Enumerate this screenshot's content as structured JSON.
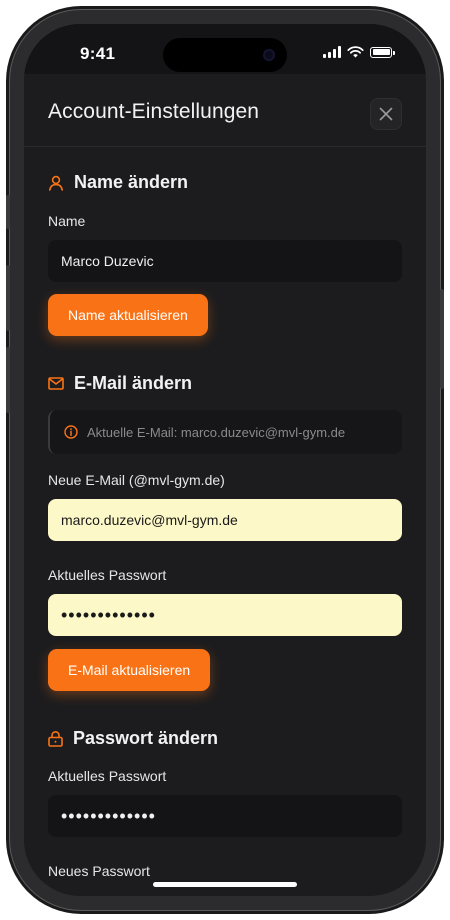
{
  "status_bar": {
    "time": "9:41"
  },
  "header": {
    "title": "Account-Einstellungen",
    "close_icon": "close-icon"
  },
  "sections": {
    "name": {
      "icon": "user-icon",
      "title": "Name ändern",
      "field_label": "Name",
      "field_value": "Marco Duzevic",
      "button_label": "Name aktualisieren"
    },
    "email": {
      "icon": "mail-icon",
      "title": "E-Mail ändern",
      "info_icon": "info-icon",
      "current_email_info": "Aktuelle E-Mail: marco.duzevic@mvl-gym.de",
      "new_email_label": "Neue E-Mail (@mvl-gym.de)",
      "new_email_value": "marco.duzevic@mvl-gym.de",
      "password_label": "Aktuelles Passwort",
      "password_value": "•••••••••••••",
      "button_label": "E-Mail aktualisieren"
    },
    "password": {
      "icon": "lock-icon",
      "title": "Passwort ändern",
      "current_label": "Aktuelles Passwort",
      "current_value": "•••••••••••••",
      "new_label": "Neues Passwort"
    }
  },
  "colors": {
    "accent": "#f97316",
    "background": "#1c1c1e",
    "autofill": "#fcf8c8"
  }
}
